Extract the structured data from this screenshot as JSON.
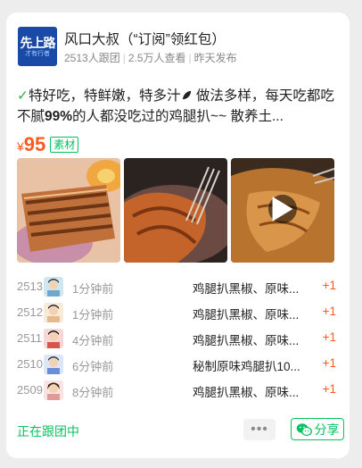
{
  "header": {
    "avatar_text_big": "先上路",
    "avatar_text_small": "才有行者",
    "title": "风口大叔（“订阅”领红包）",
    "followers": "2513人跟团",
    "views": "2.5万人查看",
    "published": "昨天发布"
  },
  "post": {
    "desc_prefix": "特好吃，特鲜嫩，特多汁",
    "desc_middle": " 做法多样，每天吃都吃不腻",
    "desc_bold": "99%",
    "desc_suffix": "的人都没吃过的鸡腿扒~~ 散养土...",
    "price_symbol": "¥",
    "price": "95",
    "tag": "素材"
  },
  "photos": [
    {
      "name": "grilled-chicken-photo"
    },
    {
      "name": "chicken-fork-photo"
    },
    {
      "name": "chicken-video-thumb",
      "video": true
    }
  ],
  "orders": [
    {
      "num": "2513",
      "time": "1分钟前",
      "product": "鸡腿扒黑椒、原味...",
      "qty": "+1",
      "avatar_color": "#6fa8c8"
    },
    {
      "num": "2512",
      "time": "1分钟前",
      "product": "鸡腿扒黑椒、原味...",
      "qty": "+1",
      "avatar_color": "#e8b98f"
    },
    {
      "num": "2511",
      "time": "4分钟前",
      "product": "鸡腿扒黑椒、原味...",
      "qty": "+1",
      "avatar_color": "#d9534f"
    },
    {
      "num": "2510",
      "time": "6分钟前",
      "product": "秘制原味鸡腿扒10...",
      "qty": "+1",
      "avatar_color": "#6b8fd6"
    },
    {
      "num": "2509",
      "time": "8分钟前",
      "product": "鸡腿扒黑椒、原味...",
      "qty": "+1",
      "avatar_color": "#e09a9a"
    }
  ],
  "footer": {
    "status": "正在跟团中",
    "more": "•••",
    "share": "分享"
  },
  "colors": {
    "accent_green": "#07c160",
    "price_orange": "#fa5a1e"
  }
}
